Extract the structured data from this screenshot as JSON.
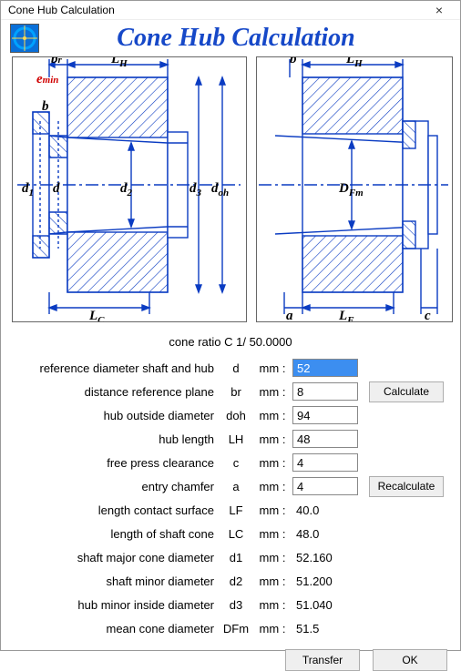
{
  "window": {
    "title": "Cone Hub Calculation",
    "close_glyph": "×"
  },
  "heading": "Cone Hub Calculation",
  "ratio_line": "cone ratio   C   1/ 50.0000",
  "inputs": {
    "d": {
      "label": "reference diameter shaft and hub",
      "sym": "d",
      "unit": "mm :",
      "value": "52",
      "highlight": true
    },
    "br": {
      "label": "distance reference plane",
      "sym": "br",
      "unit": "mm :",
      "value": "8"
    },
    "doh": {
      "label": "hub outside diameter",
      "sym": "doh",
      "unit": "mm :",
      "value": "94"
    },
    "LH": {
      "label": "hub length",
      "sym": "LH",
      "unit": "mm :",
      "value": "48"
    },
    "c": {
      "label": "free press clearance",
      "sym": "c",
      "unit": "mm :",
      "value": "4"
    },
    "a": {
      "label": "entry chamfer",
      "sym": "a",
      "unit": "mm :",
      "value": "4"
    }
  },
  "outputs": {
    "LF": {
      "label": "length contact surface",
      "sym": "LF",
      "unit": "mm :",
      "value": "40.0"
    },
    "LC": {
      "label": "length of shaft cone",
      "sym": "LC",
      "unit": "mm :",
      "value": "48.0"
    },
    "d1": {
      "label": "shaft major cone diameter",
      "sym": "d1",
      "unit": "mm :",
      "value": "52.160"
    },
    "d2": {
      "label": "shaft minor diameter",
      "sym": "d2",
      "unit": "mm :",
      "value": "51.200"
    },
    "d3": {
      "label": "hub minor inside diameter",
      "sym": "d3",
      "unit": "mm :",
      "value": "51.040"
    },
    "DFm": {
      "label": "mean cone diameter",
      "sym": "DFm",
      "unit": "mm :",
      "value": "51.5"
    }
  },
  "buttons": {
    "calculate": "Calculate",
    "recalculate": "Recalculate",
    "transfer": "Transfer",
    "ok": "OK"
  },
  "diagram_labels": {
    "left": {
      "br": "b",
      "brsub": "r",
      "emin": "e",
      "eminsub": "min",
      "b": "b",
      "LH": "L",
      "LHsub": "H",
      "LC": "L",
      "LCsub": "C",
      "d1": "d",
      "d1sub": "1",
      "d": "d",
      "d2": "d",
      "d2sub": "2",
      "d3": "d",
      "d3sub": "3",
      "doh": "d",
      "dohsub": "oh"
    },
    "right": {
      "b": "b",
      "LH": "L",
      "LHsub": "H",
      "LF": "L",
      "LFsub": "F",
      "a": "a",
      "c": "c",
      "DFm": "D",
      "DFmsub": "Fm"
    }
  }
}
